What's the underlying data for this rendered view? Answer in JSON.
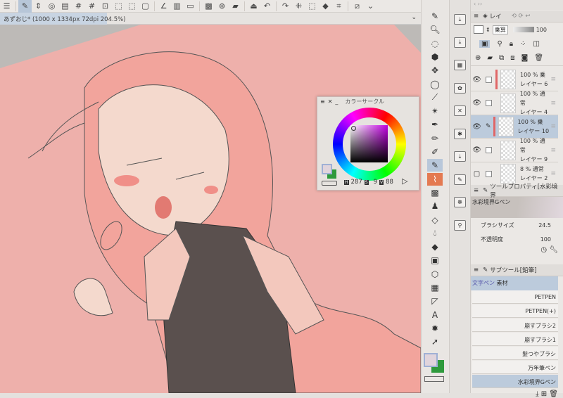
{
  "toolbar": {
    "icons": [
      "menu-icon",
      "pen-pressure-icon",
      "chevron-updown-icon",
      "spiral-icon",
      "scanner-icon",
      "grid-icon",
      "grid-alt-icon",
      "zoom-canvas-icon",
      "select-layer-icon",
      "transform-icon",
      "clear-icon",
      "ruler-icon",
      "layer-prop-icon",
      "gradient-icon",
      "tone-icon",
      "new-canvas-icon",
      "open-folder-icon",
      "save-icon",
      "undo-icon",
      "redo-icon",
      "select-all-icon",
      "deselect-icon",
      "fill-icon",
      "crop-icon",
      "hide-icon",
      "more-icon"
    ]
  },
  "document": {
    "tab_label": "あずおじ* (1000 x 1334px 72dpi 204.5%)"
  },
  "color_circle": {
    "title": "カラーサークル",
    "h_label": "H",
    "h": "287",
    "s_label": "S",
    "s": "9",
    "v_label": "V",
    "v": "88",
    "main_color": "#e0d4dc",
    "sub_color": "#2e9a3c"
  },
  "layer_panel": {
    "tab_label": "レイ",
    "blend_mode": "乗算",
    "opacity": "100",
    "layers": [
      {
        "opacity_mode": "100 % 乗",
        "name": "レイヤー 6",
        "visible": true,
        "selected": false,
        "mark": true
      },
      {
        "opacity_mode": "100 % 通常",
        "name": "レイヤー 4",
        "visible": true,
        "selected": false,
        "mark": false
      },
      {
        "opacity_mode": "100 % 乗",
        "name": "レイヤー 10",
        "visible": true,
        "selected": true,
        "mark": true
      },
      {
        "opacity_mode": "100 % 通常",
        "name": "レイヤー 9",
        "visible": true,
        "selected": false,
        "mark": false
      },
      {
        "opacity_mode": "8 % 通常",
        "name": "レイヤー 2",
        "visible": false,
        "selected": false,
        "mark": false
      }
    ]
  },
  "tool_property": {
    "title": "ツールプロパティ[水彩境界",
    "brush_name": "水彩境界Gペン",
    "brush_size_label": "ブラシサイズ",
    "brush_size": "24.5",
    "opacity_label": "不透明度",
    "opacity": "100"
  },
  "sub_tool": {
    "title": "サブツール[鉛筆]",
    "group_label": "文字ペン",
    "group_name": "素材",
    "items": [
      "PETPEN",
      "PETPEN(+)",
      "崩すブラシ2",
      "崩すブラシ1",
      "髪つやブラシ",
      "万年筆ペン",
      "水彩境界Gペン"
    ],
    "selected": "水彩境界Gペン"
  },
  "colors": {
    "canvas_bg": "#eeb0ab",
    "selection": "#b8c7da"
  }
}
